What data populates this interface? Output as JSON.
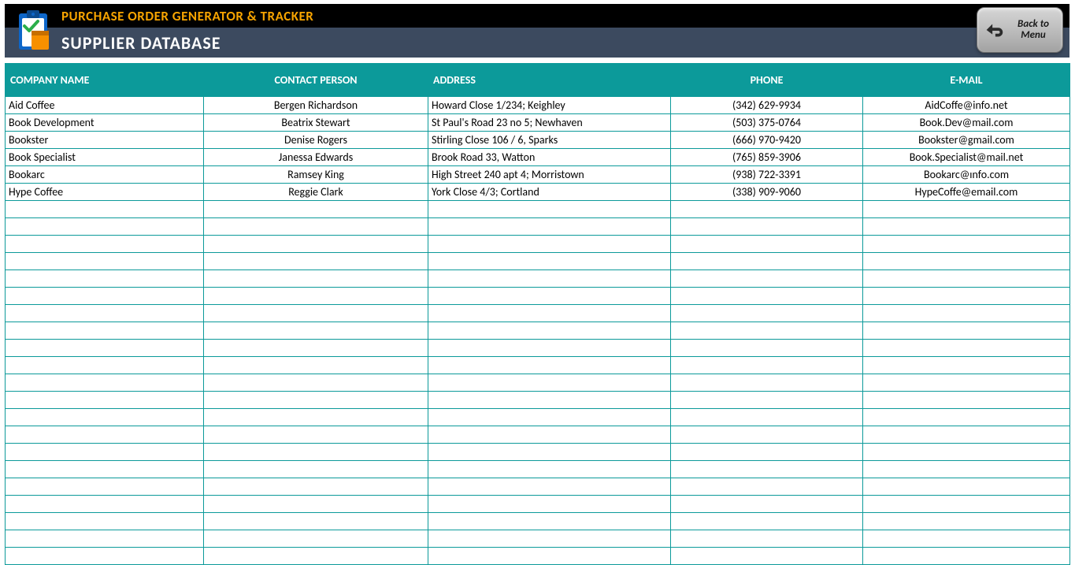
{
  "header": {
    "title_small": "PURCHASE ORDER GENERATOR & TRACKER",
    "title_large": "SUPPLIER DATABASE",
    "back_button": "Back to Menu"
  },
  "table": {
    "columns": [
      "COMPANY NAME",
      "CONTACT PERSON",
      "ADDRESS",
      "PHONE",
      "E-MAIL"
    ],
    "rows": [
      {
        "company": "Aid Coffee",
        "contact": "Bergen Richardson",
        "address": "Howard Close 1/234; Keighley",
        "phone": "(342) 629-9934",
        "email": "AidCoffe@info.net"
      },
      {
        "company": "Book Development",
        "contact": "Beatrix Stewart",
        "address": "St Paul's Road 23 no 5; Newhaven",
        "phone": "(503) 375-0764",
        "email": "Book.Dev@mail.com"
      },
      {
        "company": "Bookster",
        "contact": "Denise Rogers",
        "address": "Stirling Close 106 / 6, Sparks",
        "phone": "(666) 970-9420",
        "email": "Bookster@gmail.com"
      },
      {
        "company": "Book Specialist",
        "contact": "Janessa Edwards",
        "address": "Brook Road 33, Watton",
        "phone": "(765) 859-3906",
        "email": "Book.Specialist@mail.net"
      },
      {
        "company": "Bookarc",
        "contact": "Ramsey King",
        "address": "High Street 240 apt 4; Morristown",
        "phone": "(938) 722-3391",
        "email": "Bookarc@ınfo.com"
      },
      {
        "company": "Hype Coffee",
        "contact": "Reggie Clark",
        "address": "York Close 4/3; Cortland",
        "phone": "(338) 909-9060",
        "email": "HypeCoffe@email.com"
      }
    ],
    "empty_row_count": 21
  }
}
